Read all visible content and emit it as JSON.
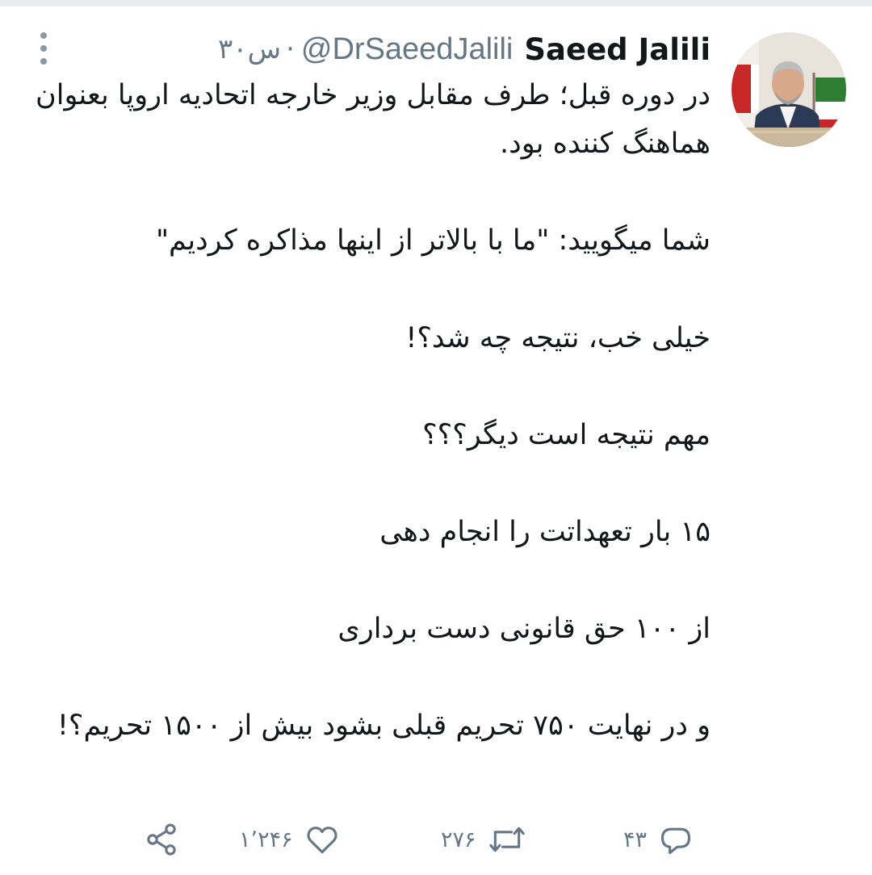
{
  "tweet": {
    "author": {
      "display_name": "Saeed Jalili",
      "handle": "@DrSaeedJalili"
    },
    "separator": "·",
    "time": "۳۰س",
    "paragraphs": [
      "در دوره قبل؛ طرف مقابل وزیر خارجه اتحادیه اروپا بعنوان هماهنگ کننده بود.",
      "شما میگویید: \"ما با بالاتر از اینها مذاکره کردیم\"",
      "خیلی خب، نتیجه چه شد؟!",
      "مهم نتیجه است دیگر؟؟؟",
      "۱۵ بار تعهداتت را انجام دهی",
      "از ۱۰۰ حق قانونی دست برداری",
      "و در نهایت ۷۵۰ تحریم قبلی بشود بیش از ۱۵۰۰ تحریم؟!"
    ]
  },
  "actions": {
    "reply_count": "۴۳",
    "retweet_count": "۲۷۶",
    "like_count": "۱٬۲۴۶"
  },
  "icons": {
    "menu": "more-vertical-icon",
    "reply": "reply-icon",
    "retweet": "retweet-icon",
    "like": "heart-icon",
    "share": "share-icon"
  },
  "colors": {
    "text": "#14171a",
    "secondary": "#657786",
    "icon": "#657786",
    "divider": "#e6ecf0"
  }
}
